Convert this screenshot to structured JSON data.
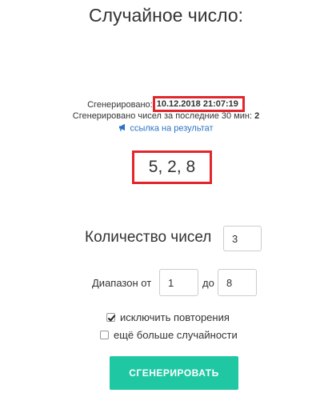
{
  "title": "Случайное число:",
  "generated": {
    "label": "Сгенерировано:",
    "timestamp": "10.12.2018 21:07:19"
  },
  "count_30min": {
    "label": "Сгенерировано чисел за последние 30 мин:",
    "value": "2"
  },
  "result_link": {
    "label": "ссылка на результат",
    "icon": "megaphone-icon"
  },
  "result": "5, 2, 8",
  "quantity": {
    "label": "Количество чисел",
    "value": "3"
  },
  "range": {
    "from_label": "Диапазон от",
    "from_value": "1",
    "to_label": "до",
    "to_value": "8"
  },
  "options": {
    "exclude_repeats": {
      "label": "исключить повторения",
      "checked": true
    },
    "more_random": {
      "label": "ещё больше случайности",
      "checked": false
    }
  },
  "generate_button": "СГЕНЕРИРОВАТЬ",
  "colors": {
    "accent": "#1fc8a3",
    "highlight_border": "#e2262b",
    "link": "#2b72c3"
  }
}
